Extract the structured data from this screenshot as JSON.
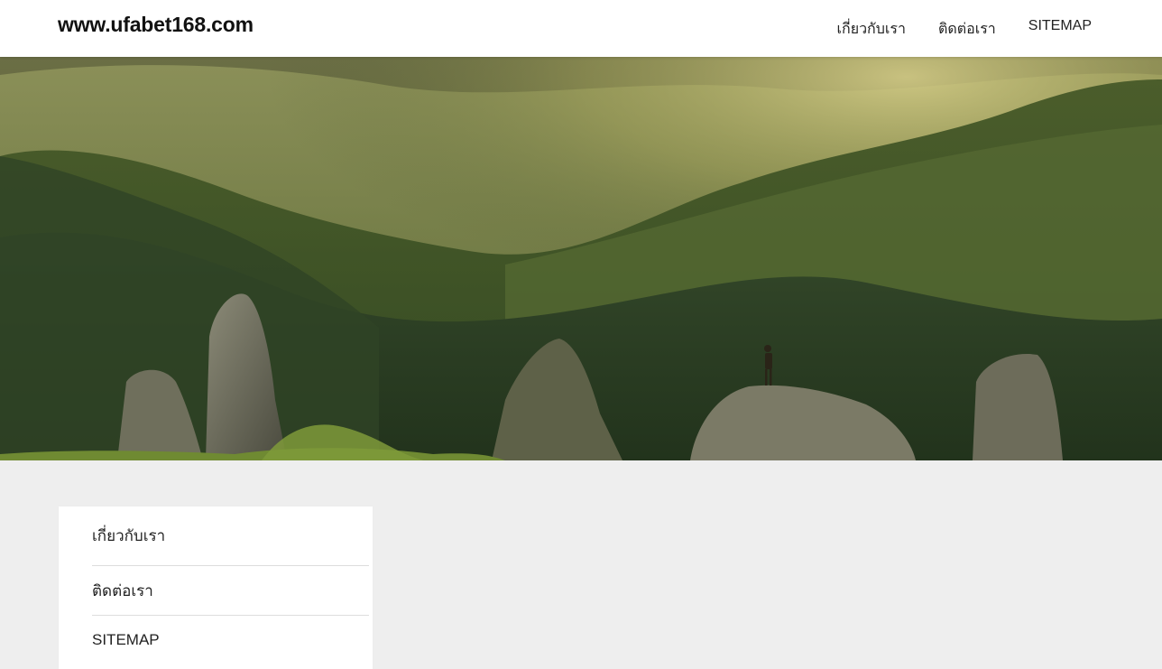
{
  "header": {
    "site_title": "www.ufabet168.com",
    "nav": [
      {
        "label": "เกี่ยวกับเรา"
      },
      {
        "label": "ติดต่อเรา"
      },
      {
        "label": "SITEMAP"
      }
    ]
  },
  "sidebar_widget": {
    "items": [
      {
        "label": "เกี่ยวกับเรา"
      },
      {
        "label": "ติดต่อเรา"
      },
      {
        "label": "SITEMAP"
      }
    ]
  },
  "colors": {
    "page_background": "#eeeeee",
    "header_background": "#ffffff",
    "text": "#222222"
  }
}
